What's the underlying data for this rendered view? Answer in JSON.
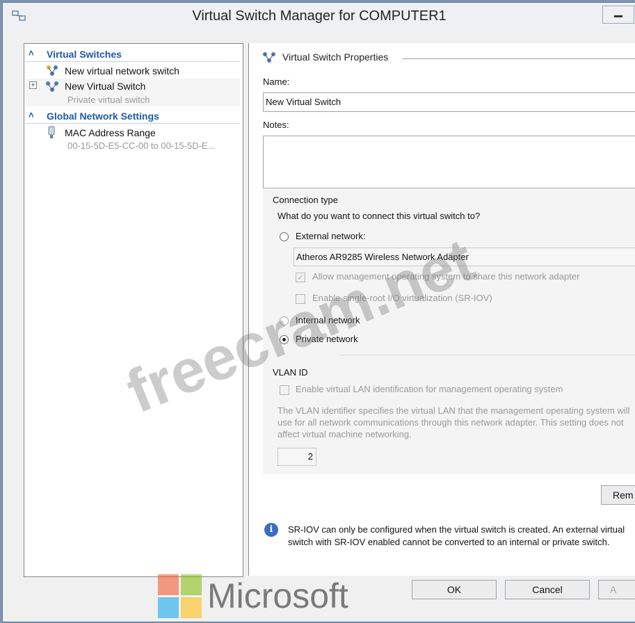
{
  "window": {
    "title": "Virtual Switch Manager for COMPUTER1"
  },
  "tree": {
    "virtual_switches_header": "Virtual Switches",
    "new_switch_item": "New virtual network switch",
    "switch_name": "New Virtual Switch",
    "switch_sub": "Private virtual switch",
    "global_header": "Global Network Settings",
    "mac_range_label": "MAC Address Range",
    "mac_range_value": "00-15-5D-E5-CC-00 to 00-15-5D-E..."
  },
  "properties": {
    "section_title": "Virtual Switch Properties",
    "name_label": "Name:",
    "name_value": "New Virtual Switch",
    "notes_label": "Notes:",
    "notes_value": "",
    "connection_type_title": "Connection type",
    "connection_question": "What do you want to connect this virtual switch to?",
    "external_label": "External network:",
    "adapter_value": "Atheros AR9285 Wireless Network Adapter",
    "allow_mgmt_label": "Allow management operating system to share this network adapter",
    "sriov_label": "Enable single-root I/O virtualization (SR-IOV)",
    "internal_label": "Internal network",
    "private_label": "Private network",
    "selected_connection": "private",
    "vlan_title": "VLAN ID",
    "vlan_enable_label": "Enable virtual LAN identification for management operating system",
    "vlan_desc": "The VLAN identifier specifies the virtual LAN that the management operating system will use for all network communications through this network adapter. This setting does not affect virtual machine networking.",
    "vlan_value": "2",
    "remove_button": "Rem",
    "info_text": "SR-IOV can only be configured when the virtual switch is created. An external virtual switch with SR-IOV enabled cannot be converted to an internal or private switch."
  },
  "buttons": {
    "ok": "OK",
    "cancel": "Cancel",
    "apply": "A"
  },
  "overlay": {
    "watermark": "freecram.net",
    "logo_text": "Microsoft"
  },
  "colors": {
    "accent": "#1e5aa8",
    "logo_red": "#f25022",
    "logo_green": "#7fba00",
    "logo_blue": "#00a4ef",
    "logo_yellow": "#ffb900"
  }
}
